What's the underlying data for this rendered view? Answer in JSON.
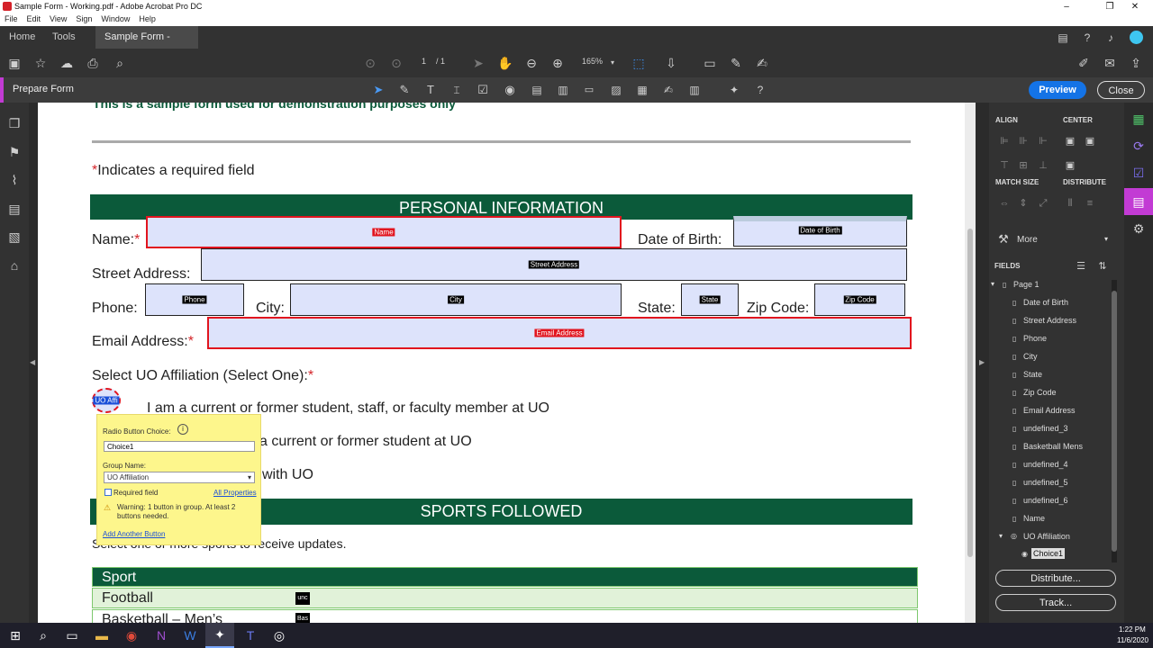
{
  "window": {
    "title": "Sample Form - Working.pdf - Adobe Acrobat Pro DC"
  },
  "menu": [
    "File",
    "Edit",
    "View",
    "Sign",
    "Window",
    "Help"
  ],
  "tabs": {
    "home": "Home",
    "tools": "Tools",
    "doc": "Sample Form - Wor...",
    "close": "×"
  },
  "toolbar": {
    "page_current": "1",
    "page_total": "/ 1",
    "zoom": "165%"
  },
  "prepare": {
    "label": "Prepare Form",
    "preview": "Preview",
    "close": "Close"
  },
  "form": {
    "intro": "This is a sample form used for demonstration purposes only",
    "req_star": "*",
    "req_note": "Indicates a required field",
    "personal_header": "PERSONAL INFORMATION",
    "name_label": "Name:",
    "dob_label": "Date of Birth:",
    "street_label": "Street Address:",
    "phone_label": "Phone:",
    "city_label": "City:",
    "state_label": "State:",
    "zip_label": "Zip Code:",
    "email_label": "Email Address:",
    "affil_label": "Select UO Affiliation (Select One):",
    "opt1": "I am a current or former student, staff, or faculty member at UO",
    "opt2": "a current or former student at UO",
    "opt3": "with UO",
    "sports_header": "SPORTS FOLLOWED",
    "sports_note": "Select one or more sports to receive updates.",
    "sport_col": "Sport",
    "sport1": "Football",
    "sport2": "Basketball – Men’s"
  },
  "fields": {
    "name": "Name",
    "dob": "Date of Birth",
    "street": "Street Address",
    "phone": "Phone",
    "city": "City",
    "state": "State",
    "zip": "Zip Code",
    "email": "Email Address",
    "radio": "UO Affi",
    "fb": "unc",
    "bb": "Bas"
  },
  "popup": {
    "title": "Radio Button Choice:",
    "choice_value": "Choice1",
    "group_label": "Group Name:",
    "group_value": "UO Affiliation",
    "required": "Required field",
    "all_props": "All Properties",
    "warning": "Warning: 1 button in group. At least 2 buttons needed.",
    "add": "Add Another Button"
  },
  "rpanel": {
    "align": "ALIGN",
    "center": "CENTER",
    "match": "MATCH SIZE",
    "distribute": "DISTRIBUTE",
    "more": "More",
    "fields": "FIELDS",
    "page": "Page 1",
    "items": [
      "Date of Birth",
      "Street Address",
      "Phone",
      "City",
      "State",
      "Zip Code",
      "Email Address",
      "undefined_3",
      "Basketball Mens",
      "undefined_4",
      "undefined_5",
      "undefined_6",
      "Name"
    ],
    "group": "UO Affiliation",
    "choice": "Choice1",
    "distribute_btn": "Distribute...",
    "track_btn": "Track..."
  },
  "clock": {
    "time": "1:22 PM",
    "date": "11/6/2020"
  },
  "colors": {
    "accent": "#c23bd4",
    "preview": "#1473e6",
    "form_green": "#0b5a3a",
    "required_red": "#e1141e"
  }
}
